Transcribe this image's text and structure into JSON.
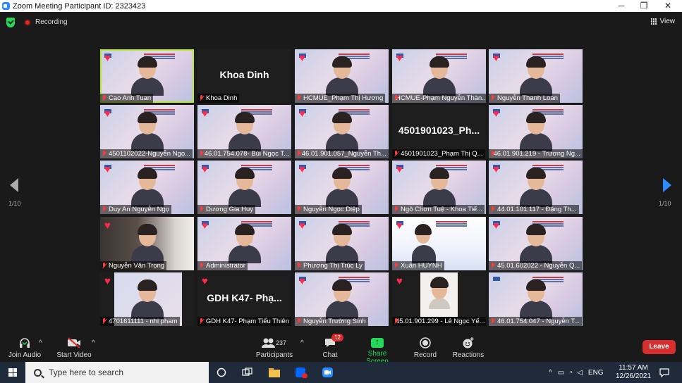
{
  "window": {
    "title": "Zoom Meeting Participant ID: 2323423",
    "minimize": "─",
    "maximize": "❐",
    "close": "✕"
  },
  "topbar": {
    "recording_label": "Recording",
    "view_label": "View"
  },
  "pagination": {
    "left": "1/10",
    "right": "1/10"
  },
  "tiles": [
    {
      "name": "Cao Anh Tuan",
      "kind": "video",
      "heart": true
    },
    {
      "name": "Khoa Dinh",
      "kind": "dark",
      "big": "Khoa Dinh",
      "heart": false
    },
    {
      "name": "HCMUE_Phạm Thị Hương",
      "kind": "video",
      "heart": true
    },
    {
      "name": "HCMUE-Phạm Nguyễn Thàn...",
      "kind": "video",
      "heart": true
    },
    {
      "name": "Nguyễn Thanh Loan",
      "kind": "video",
      "heart": true
    },
    {
      "name": "4501102022-Nguyễn Ngọ...",
      "kind": "video",
      "heart": true
    },
    {
      "name": "46.01.754.078- Bùi  Ngọc T...",
      "kind": "video",
      "heart": true
    },
    {
      "name": "46.01.901.057_Nguyễn Th...",
      "kind": "video",
      "heart": true
    },
    {
      "name": "4501901023_Phạm Thị Q...",
      "kind": "dark",
      "big": "4501901023_Ph...",
      "heart": false
    },
    {
      "name": "46.01.901.219 - Trương Ng...",
      "kind": "video",
      "heart": true
    },
    {
      "name": "Duy An Nguyễn Ngọ",
      "kind": "video",
      "heart": true
    },
    {
      "name": "Dương Gia Huy",
      "kind": "video",
      "heart": true
    },
    {
      "name": "Nguyễn Ngọc Diệp",
      "kind": "video",
      "heart": true
    },
    {
      "name": "Ngô Chơn Tuệ - Khoa Tiế...",
      "kind": "video",
      "heart": true
    },
    {
      "name": "44.01.101.117 - Đặng Th...",
      "kind": "video",
      "heart": true
    },
    {
      "name": "Nguyễn Văn Trọng",
      "kind": "room",
      "heart": true
    },
    {
      "name": "Administrator",
      "kind": "video",
      "heart": true
    },
    {
      "name": "Phương Thị Trúc Ly",
      "kind": "video",
      "heart": true
    },
    {
      "name": "Xuân HUYNH",
      "kind": "slide",
      "heart": true
    },
    {
      "name": "45.01.602022 - Nguyễn Q...",
      "kind": "video",
      "heart": true
    },
    {
      "name": "4701611111 - nhi pham",
      "kind": "inset",
      "heart": true
    },
    {
      "name": "GDH K47- Phạm Tiểu Thiên",
      "kind": "dark",
      "big": "GDH  K47-  Phạ...",
      "heart": true
    },
    {
      "name": "Nguyễn Trường Sinh",
      "kind": "video",
      "heart": true
    },
    {
      "name": "45.01.901.299 - Lê Ngọc Yế...",
      "kind": "white",
      "heart": true
    },
    {
      "name": "46.01.754.047 - Nguyễn T...",
      "kind": "video",
      "heart": false
    }
  ],
  "controls": {
    "join_audio": "Join Audio",
    "start_video": "Start Video",
    "participants": "Participants",
    "participants_count": "237",
    "chat": "Chat",
    "chat_badge": "12",
    "share_screen": "Share Screen",
    "record": "Record",
    "reactions": "Reactions",
    "leave": "Leave"
  },
  "taskbar": {
    "search_placeholder": "Type here to search",
    "lang": "ENG",
    "time": "11:57 AM",
    "date": "12/26/2021"
  },
  "colors": {
    "accent": "#2d8cff",
    "share_green": "#23d959",
    "leave_red": "#d72f2f",
    "heart_red": "#ff2a4d",
    "active_speaker": "#b9e63a"
  }
}
